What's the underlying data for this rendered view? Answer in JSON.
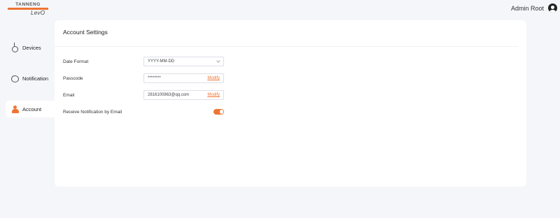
{
  "logo": {
    "brand": "TANNENG",
    "product": "LevO"
  },
  "header": {
    "user_name": "Admin Root"
  },
  "sidebar": {
    "items": [
      {
        "label": "Devices",
        "icon": "devices-icon",
        "active": false
      },
      {
        "label": "Notification",
        "icon": "notification-icon",
        "active": false
      },
      {
        "label": "Account",
        "icon": "account-icon",
        "active": true
      }
    ]
  },
  "main": {
    "title": "Account Settings",
    "date_format": {
      "label": "Date Format",
      "value": "YYYY-MM-DD"
    },
    "passcode": {
      "label": "Passcode",
      "value": "********",
      "action": "Modify"
    },
    "email": {
      "label": "Email",
      "value": "2816100863@qq.com",
      "action": "Modify"
    },
    "notify_email": {
      "label": "Receive Notification by Email",
      "enabled": true
    }
  },
  "colors": {
    "accent": "#ee7434",
    "background": "#f5f6fa",
    "panel": "#ffffff"
  }
}
